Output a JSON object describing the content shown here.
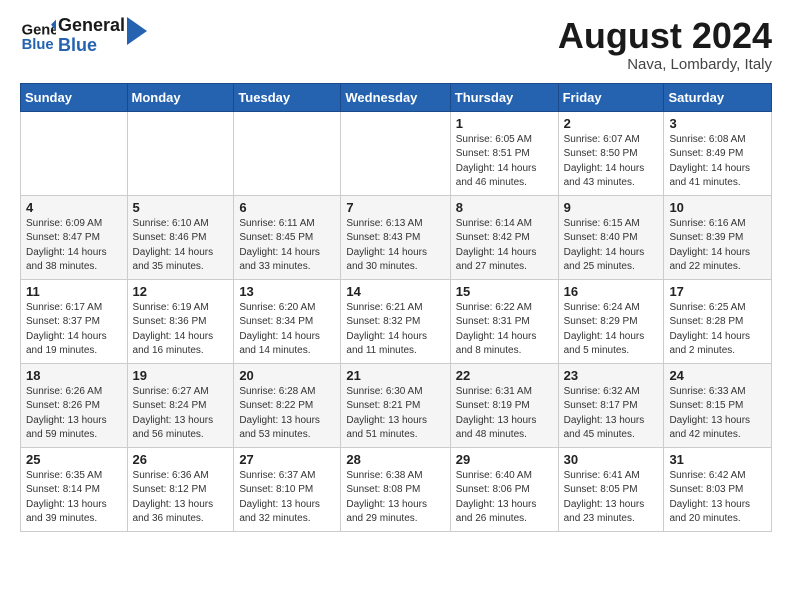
{
  "header": {
    "logo_line1": "General",
    "logo_line2": "Blue",
    "month": "August 2024",
    "location": "Nava, Lombardy, Italy"
  },
  "weekdays": [
    "Sunday",
    "Monday",
    "Tuesday",
    "Wednesday",
    "Thursday",
    "Friday",
    "Saturday"
  ],
  "weeks": [
    [
      {
        "day": "",
        "info": ""
      },
      {
        "day": "",
        "info": ""
      },
      {
        "day": "",
        "info": ""
      },
      {
        "day": "",
        "info": ""
      },
      {
        "day": "1",
        "info": "Sunrise: 6:05 AM\nSunset: 8:51 PM\nDaylight: 14 hours\nand 46 minutes."
      },
      {
        "day": "2",
        "info": "Sunrise: 6:07 AM\nSunset: 8:50 PM\nDaylight: 14 hours\nand 43 minutes."
      },
      {
        "day": "3",
        "info": "Sunrise: 6:08 AM\nSunset: 8:49 PM\nDaylight: 14 hours\nand 41 minutes."
      }
    ],
    [
      {
        "day": "4",
        "info": "Sunrise: 6:09 AM\nSunset: 8:47 PM\nDaylight: 14 hours\nand 38 minutes."
      },
      {
        "day": "5",
        "info": "Sunrise: 6:10 AM\nSunset: 8:46 PM\nDaylight: 14 hours\nand 35 minutes."
      },
      {
        "day": "6",
        "info": "Sunrise: 6:11 AM\nSunset: 8:45 PM\nDaylight: 14 hours\nand 33 minutes."
      },
      {
        "day": "7",
        "info": "Sunrise: 6:13 AM\nSunset: 8:43 PM\nDaylight: 14 hours\nand 30 minutes."
      },
      {
        "day": "8",
        "info": "Sunrise: 6:14 AM\nSunset: 8:42 PM\nDaylight: 14 hours\nand 27 minutes."
      },
      {
        "day": "9",
        "info": "Sunrise: 6:15 AM\nSunset: 8:40 PM\nDaylight: 14 hours\nand 25 minutes."
      },
      {
        "day": "10",
        "info": "Sunrise: 6:16 AM\nSunset: 8:39 PM\nDaylight: 14 hours\nand 22 minutes."
      }
    ],
    [
      {
        "day": "11",
        "info": "Sunrise: 6:17 AM\nSunset: 8:37 PM\nDaylight: 14 hours\nand 19 minutes."
      },
      {
        "day": "12",
        "info": "Sunrise: 6:19 AM\nSunset: 8:36 PM\nDaylight: 14 hours\nand 16 minutes."
      },
      {
        "day": "13",
        "info": "Sunrise: 6:20 AM\nSunset: 8:34 PM\nDaylight: 14 hours\nand 14 minutes."
      },
      {
        "day": "14",
        "info": "Sunrise: 6:21 AM\nSunset: 8:32 PM\nDaylight: 14 hours\nand 11 minutes."
      },
      {
        "day": "15",
        "info": "Sunrise: 6:22 AM\nSunset: 8:31 PM\nDaylight: 14 hours\nand 8 minutes."
      },
      {
        "day": "16",
        "info": "Sunrise: 6:24 AM\nSunset: 8:29 PM\nDaylight: 14 hours\nand 5 minutes."
      },
      {
        "day": "17",
        "info": "Sunrise: 6:25 AM\nSunset: 8:28 PM\nDaylight: 14 hours\nand 2 minutes."
      }
    ],
    [
      {
        "day": "18",
        "info": "Sunrise: 6:26 AM\nSunset: 8:26 PM\nDaylight: 13 hours\nand 59 minutes."
      },
      {
        "day": "19",
        "info": "Sunrise: 6:27 AM\nSunset: 8:24 PM\nDaylight: 13 hours\nand 56 minutes."
      },
      {
        "day": "20",
        "info": "Sunrise: 6:28 AM\nSunset: 8:22 PM\nDaylight: 13 hours\nand 53 minutes."
      },
      {
        "day": "21",
        "info": "Sunrise: 6:30 AM\nSunset: 8:21 PM\nDaylight: 13 hours\nand 51 minutes."
      },
      {
        "day": "22",
        "info": "Sunrise: 6:31 AM\nSunset: 8:19 PM\nDaylight: 13 hours\nand 48 minutes."
      },
      {
        "day": "23",
        "info": "Sunrise: 6:32 AM\nSunset: 8:17 PM\nDaylight: 13 hours\nand 45 minutes."
      },
      {
        "day": "24",
        "info": "Sunrise: 6:33 AM\nSunset: 8:15 PM\nDaylight: 13 hours\nand 42 minutes."
      }
    ],
    [
      {
        "day": "25",
        "info": "Sunrise: 6:35 AM\nSunset: 8:14 PM\nDaylight: 13 hours\nand 39 minutes."
      },
      {
        "day": "26",
        "info": "Sunrise: 6:36 AM\nSunset: 8:12 PM\nDaylight: 13 hours\nand 36 minutes."
      },
      {
        "day": "27",
        "info": "Sunrise: 6:37 AM\nSunset: 8:10 PM\nDaylight: 13 hours\nand 32 minutes."
      },
      {
        "day": "28",
        "info": "Sunrise: 6:38 AM\nSunset: 8:08 PM\nDaylight: 13 hours\nand 29 minutes."
      },
      {
        "day": "29",
        "info": "Sunrise: 6:40 AM\nSunset: 8:06 PM\nDaylight: 13 hours\nand 26 minutes."
      },
      {
        "day": "30",
        "info": "Sunrise: 6:41 AM\nSunset: 8:05 PM\nDaylight: 13 hours\nand 23 minutes."
      },
      {
        "day": "31",
        "info": "Sunrise: 6:42 AM\nSunset: 8:03 PM\nDaylight: 13 hours\nand 20 minutes."
      }
    ]
  ]
}
